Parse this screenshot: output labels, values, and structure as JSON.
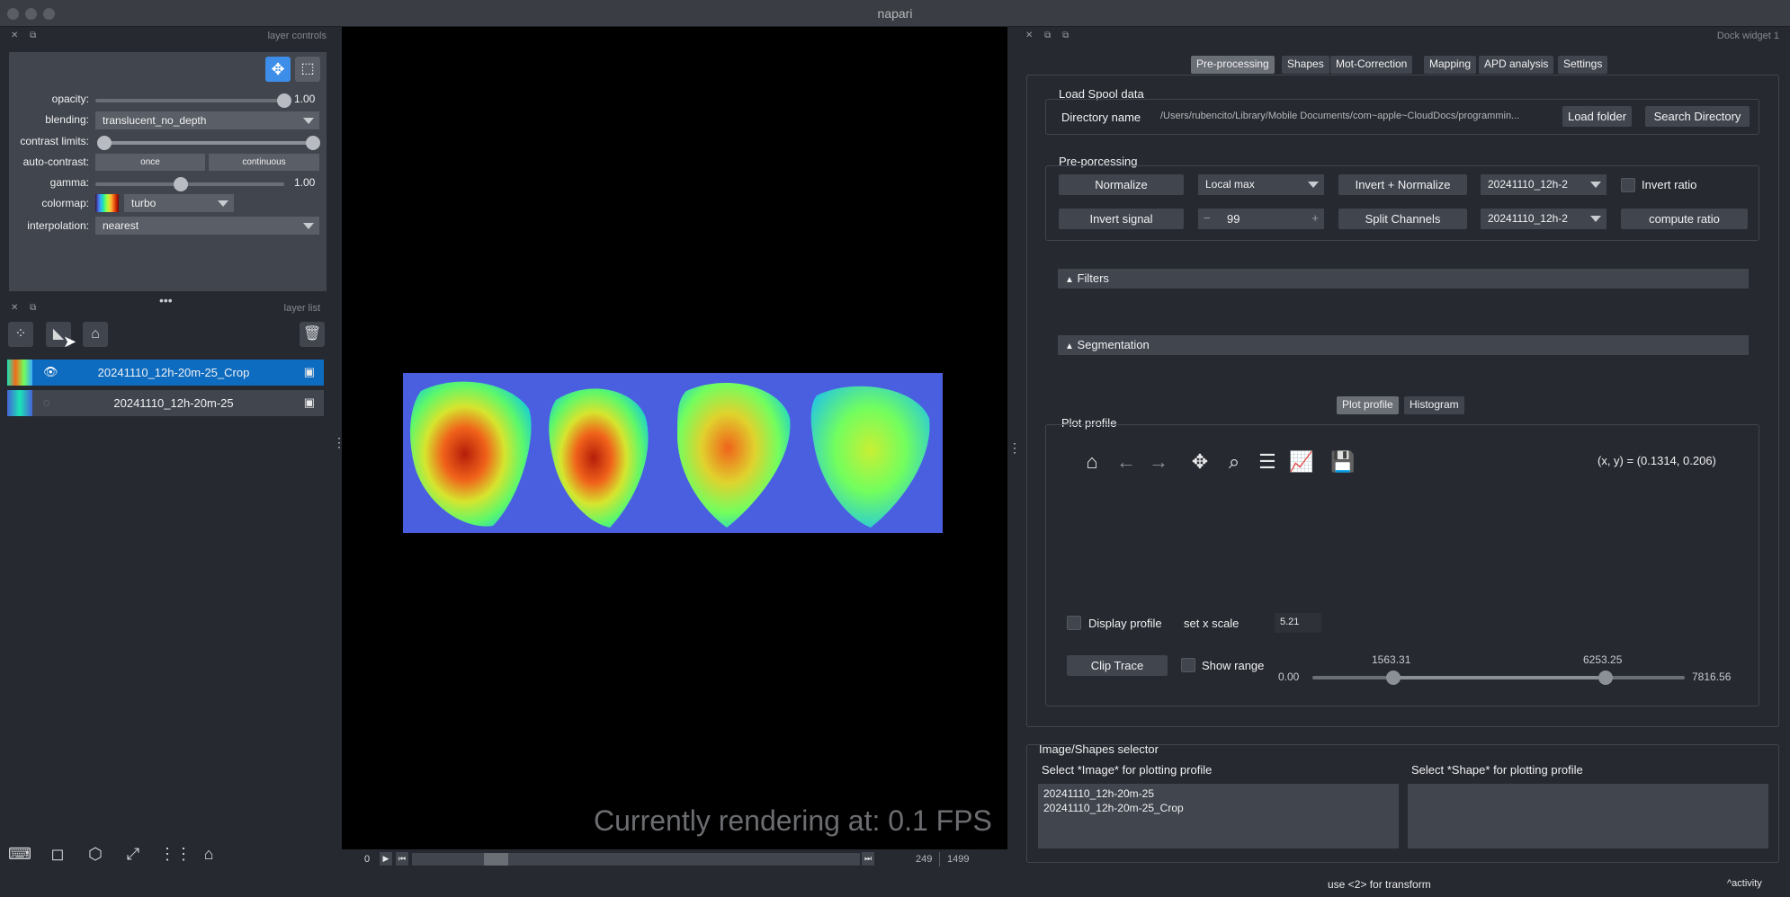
{
  "window": {
    "title": "napari"
  },
  "left": {
    "layer_controls_header": "layer controls",
    "layer_list_header": "layer list",
    "controls": {
      "opacity_label": "opacity:",
      "opacity_value": "1.00",
      "opacity_level": 1.0,
      "blending_label": "blending:",
      "blending_value": "translucent_no_depth",
      "contrast_label": "contrast limits:",
      "autocontrast_label": "auto-contrast:",
      "once_label": "once",
      "continuous_label": "continuous",
      "gamma_label": "gamma:",
      "gamma_value": "1.00",
      "colormap_label": "colormap:",
      "colormap_value": "turbo",
      "interpolation_label": "interpolation:",
      "interpolation_value": "nearest"
    },
    "layers": [
      {
        "name": "20241110_12h-20m-25_Crop",
        "selected": true,
        "visible": true
      },
      {
        "name": "20241110_12h-20m-25",
        "selected": false,
        "visible": false
      }
    ]
  },
  "canvas": {
    "fps_text": "Currently rendering at: 0.1 FPS",
    "frame_start": "0",
    "frame_current": "249",
    "frame_total": "1499"
  },
  "right": {
    "dock_title": "Dock widget 1",
    "tabs": [
      "Pre-processing",
      "Shapes",
      "Mot-Correction",
      "Mapping",
      "APD analysis",
      "Settings"
    ],
    "load": {
      "title": "Load Spool data",
      "dir_label": "Directory name",
      "dir_value": "/Users/rubencito/Library/Mobile Documents/com~apple~CloudDocs/programmin...",
      "load_folder": "Load folder",
      "search_dir": "Search Directory"
    },
    "prep": {
      "title": "Pre-porcessing",
      "normalize": "Normalize",
      "local_max": "Local max",
      "invert_normalize": "Invert + Normalize",
      "combo1": "20241110_12h-2",
      "invert_ratio": "Invert ratio",
      "invert_signal": "Invert signal",
      "spin_value": "99",
      "split_channels": "Split Channels",
      "combo2": "20241110_12h-2",
      "compute_ratio": "compute ratio"
    },
    "filters_label": "Filters",
    "segmentation_label": "Segmentation",
    "plot_tabs": [
      "Plot profile",
      "Histogram"
    ],
    "plot": {
      "title": "Plot profile",
      "coords": "(x, y) = (0.1314, 0.206)",
      "display_profile": "Display profile",
      "set_x_scale": "set x scale",
      "x_scale_value": "5.21",
      "clip_trace": "Clip Trace",
      "show_range": "Show range",
      "range_min": "0.00",
      "range_max": "7816.56",
      "handle_low": "1563.31",
      "handle_high": "6253.25"
    },
    "selector": {
      "title": "Image/Shapes selector",
      "image_label": "Select *Image* for plotting profile",
      "shape_label": "Select *Shape* for plotting profile",
      "images": [
        "20241110_12h-20m-25",
        "20241110_12h-20m-25_Crop"
      ]
    }
  },
  "status": {
    "hint": "use <2> for transform",
    "activity": "activity"
  }
}
